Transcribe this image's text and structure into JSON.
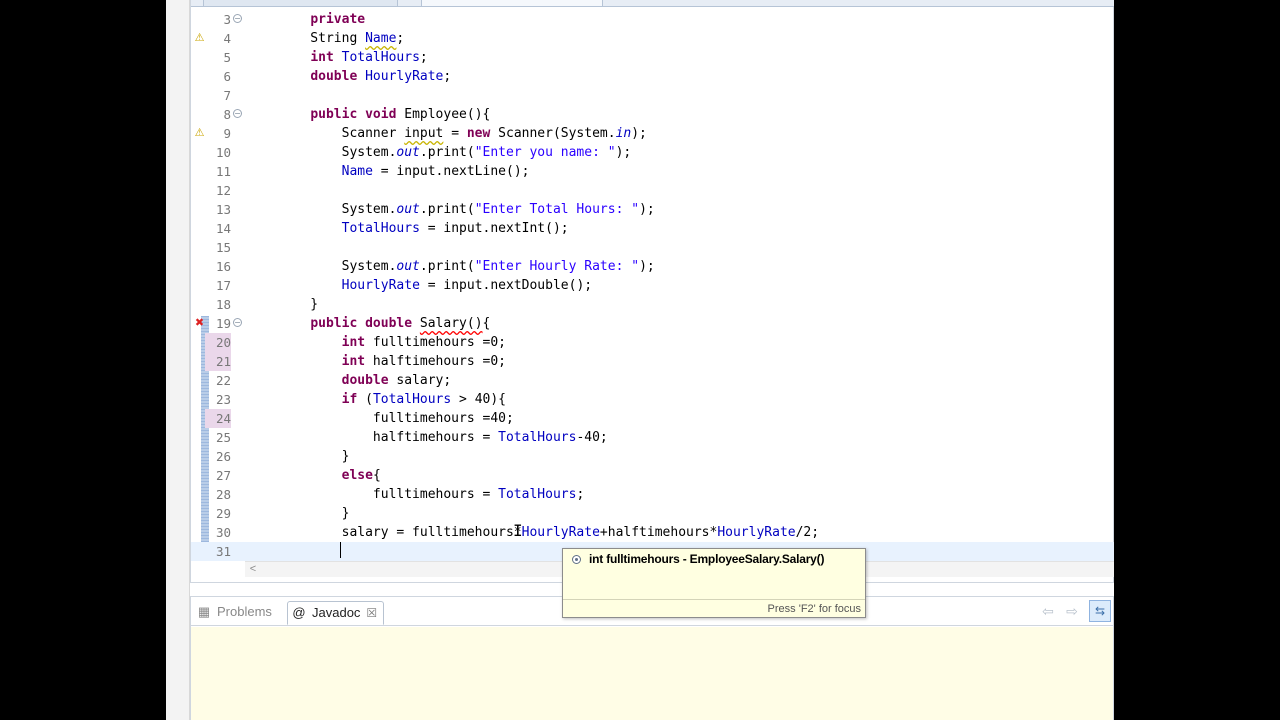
{
  "editor": {
    "lines": [
      {
        "n": "3",
        "fold": "−",
        "marker": "",
        "hl": false,
        "tokens": [
          [
            "    ",
            ""
          ],
          [
            "private",
            "kw"
          ]
        ]
      },
      {
        "n": "4",
        "fold": "",
        "marker": "warning-bulb",
        "hl": false,
        "tokens": [
          [
            "    String ",
            ""
          ],
          [
            "Name",
            "fld warn"
          ],
          [
            ";",
            ""
          ]
        ]
      },
      {
        "n": "5",
        "fold": "",
        "marker": "",
        "hl": false,
        "tokens": [
          [
            "    ",
            ""
          ],
          [
            "int",
            "kw"
          ],
          [
            " ",
            ""
          ],
          [
            "TotalHours",
            "fld"
          ],
          [
            ";",
            ""
          ]
        ]
      },
      {
        "n": "6",
        "fold": "",
        "marker": "",
        "hl": false,
        "tokens": [
          [
            "    ",
            ""
          ],
          [
            "double",
            "kw"
          ],
          [
            " ",
            ""
          ],
          [
            "HourlyRate",
            "fld"
          ],
          [
            ";",
            ""
          ]
        ]
      },
      {
        "n": "7",
        "fold": "",
        "marker": "",
        "hl": false,
        "tokens": []
      },
      {
        "n": "8",
        "fold": "−",
        "marker": "",
        "hl": false,
        "tokens": [
          [
            "    ",
            ""
          ],
          [
            "public",
            "kw"
          ],
          [
            " ",
            ""
          ],
          [
            "void",
            "kw"
          ],
          [
            " Employee(){",
            ""
          ]
        ]
      },
      {
        "n": "9",
        "fold": "",
        "marker": "warning",
        "hl": false,
        "tokens": [
          [
            "        Scanner ",
            ""
          ],
          [
            "input",
            "warn"
          ],
          [
            " = ",
            ""
          ],
          [
            "new",
            "kw"
          ],
          [
            " Scanner(System.",
            ""
          ],
          [
            "in",
            "st"
          ],
          [
            ");",
            ""
          ]
        ]
      },
      {
        "n": "10",
        "fold": "",
        "marker": "",
        "hl": false,
        "tokens": [
          [
            "        System.",
            ""
          ],
          [
            "out",
            "st"
          ],
          [
            ".print(",
            ""
          ],
          [
            "\"Enter you name: \"",
            "str"
          ],
          [
            ");",
            ""
          ]
        ]
      },
      {
        "n": "11",
        "fold": "",
        "marker": "",
        "hl": false,
        "tokens": [
          [
            "        ",
            ""
          ],
          [
            "Name",
            "fld"
          ],
          [
            " = input.nextLine();",
            ""
          ]
        ]
      },
      {
        "n": "12",
        "fold": "",
        "marker": "",
        "hl": false,
        "tokens": []
      },
      {
        "n": "13",
        "fold": "",
        "marker": "",
        "hl": false,
        "tokens": [
          [
            "        System.",
            ""
          ],
          [
            "out",
            "st"
          ],
          [
            ".print(",
            ""
          ],
          [
            "\"Enter Total Hours: \"",
            "str"
          ],
          [
            ");",
            ""
          ]
        ]
      },
      {
        "n": "14",
        "fold": "",
        "marker": "",
        "hl": false,
        "tokens": [
          [
            "        ",
            ""
          ],
          [
            "TotalHours",
            "fld"
          ],
          [
            " = input.nextInt();",
            ""
          ]
        ]
      },
      {
        "n": "15",
        "fold": "",
        "marker": "",
        "hl": false,
        "tokens": []
      },
      {
        "n": "16",
        "fold": "",
        "marker": "",
        "hl": false,
        "tokens": [
          [
            "        System.",
            ""
          ],
          [
            "out",
            "st"
          ],
          [
            ".print(",
            ""
          ],
          [
            "\"Enter Hourly Rate: \"",
            "str"
          ],
          [
            ");",
            ""
          ]
        ]
      },
      {
        "n": "17",
        "fold": "",
        "marker": "",
        "hl": false,
        "tokens": [
          [
            "        ",
            ""
          ],
          [
            "HourlyRate",
            "fld"
          ],
          [
            " = input.nextDouble();",
            ""
          ]
        ]
      },
      {
        "n": "18",
        "fold": "",
        "marker": "",
        "hl": false,
        "tokens": [
          [
            "    }",
            ""
          ]
        ]
      },
      {
        "n": "19",
        "fold": "−",
        "marker": "error",
        "hl": false,
        "tokens": [
          [
            "    ",
            ""
          ],
          [
            "public",
            "kw"
          ],
          [
            " ",
            ""
          ],
          [
            "double",
            "kw"
          ],
          [
            " ",
            ""
          ],
          [
            "Salary()",
            "err"
          ],
          [
            "{",
            ""
          ]
        ]
      },
      {
        "n": "20",
        "fold": "",
        "marker": "",
        "hl": true,
        "tokens": [
          [
            "        ",
            ""
          ],
          [
            "int",
            "kw"
          ],
          [
            " fulltimehours =0;",
            ""
          ]
        ]
      },
      {
        "n": "21",
        "fold": "",
        "marker": "",
        "hl": true,
        "tokens": [
          [
            "        ",
            ""
          ],
          [
            "int",
            "kw"
          ],
          [
            " halftimehours =0;",
            ""
          ]
        ]
      },
      {
        "n": "22",
        "fold": "",
        "marker": "",
        "hl": false,
        "tokens": [
          [
            "        ",
            ""
          ],
          [
            "double",
            "kw"
          ],
          [
            " salary;",
            ""
          ]
        ]
      },
      {
        "n": "23",
        "fold": "",
        "marker": "",
        "hl": false,
        "tokens": [
          [
            "        ",
            ""
          ],
          [
            "if",
            "kw"
          ],
          [
            " (",
            ""
          ],
          [
            "TotalHours",
            "fld"
          ],
          [
            " > 40){",
            ""
          ]
        ]
      },
      {
        "n": "24",
        "fold": "",
        "marker": "",
        "hl": true,
        "tokens": [
          [
            "            fulltimehours =40;",
            ""
          ]
        ]
      },
      {
        "n": "25",
        "fold": "",
        "marker": "",
        "hl": false,
        "tokens": [
          [
            "            halftimehours = ",
            ""
          ],
          [
            "TotalHours",
            "fld"
          ],
          [
            "-40;",
            ""
          ]
        ]
      },
      {
        "n": "26",
        "fold": "",
        "marker": "",
        "hl": false,
        "tokens": [
          [
            "        }",
            ""
          ]
        ]
      },
      {
        "n": "27",
        "fold": "",
        "marker": "",
        "hl": false,
        "tokens": [
          [
            "        ",
            ""
          ],
          [
            "else",
            "kw"
          ],
          [
            "{",
            ""
          ]
        ]
      },
      {
        "n": "28",
        "fold": "",
        "marker": "",
        "hl": false,
        "tokens": [
          [
            "            fulltimehours = ",
            ""
          ],
          [
            "TotalHours",
            "fld"
          ],
          [
            ";",
            ""
          ]
        ]
      },
      {
        "n": "29",
        "fold": "",
        "marker": "",
        "hl": false,
        "tokens": [
          [
            "        }",
            ""
          ]
        ]
      },
      {
        "n": "30",
        "fold": "",
        "marker": "",
        "hl": false,
        "tokens": [
          [
            "        salary = fulltimehours*",
            ""
          ],
          [
            "HourlyRate",
            "fld"
          ],
          [
            "+halftimehours*",
            ""
          ],
          [
            "HourlyRate",
            "fld"
          ],
          [
            "/2;",
            ""
          ]
        ]
      },
      {
        "n": "31",
        "fold": "",
        "marker": "",
        "hl": false,
        "current": true,
        "tokens": [
          [
            "        ",
            ""
          ]
        ]
      }
    ]
  },
  "hover": {
    "signature": "int fulltimehours - EmployeeSalary.Salary()",
    "footer": "Press 'F2' for focus"
  },
  "panel": {
    "problems_label": "Problems",
    "javadoc_label": "Javadoc",
    "javadoc_icon": "@",
    "close_glyph": "☒"
  },
  "icons": {
    "warning": "⚠",
    "error": "✖",
    "nav_back": "⇦",
    "nav_forward": "⇨",
    "link": "⇆",
    "scroll_left": "<",
    "problems": "▦"
  },
  "colors": {
    "keyword": "#7f0055",
    "field": "#0000c0",
    "string": "#2a00ff",
    "javadoc_bg": "#fffde6"
  }
}
